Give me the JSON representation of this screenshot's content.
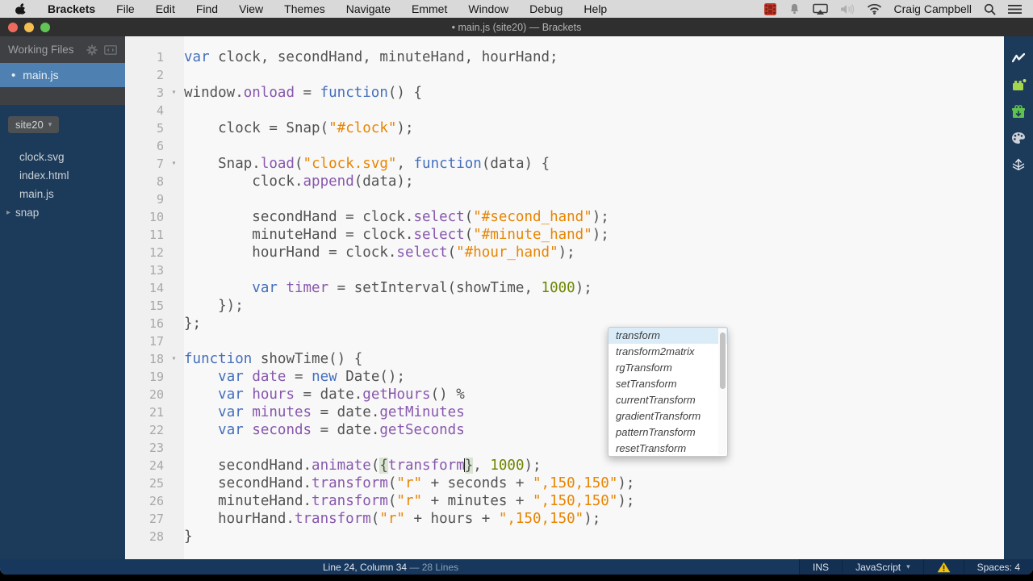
{
  "menu_bar": {
    "app_name": "Brackets",
    "items": [
      "File",
      "Edit",
      "Find",
      "View",
      "Themes",
      "Navigate",
      "Emmet",
      "Window",
      "Debug",
      "Help"
    ],
    "status_icon_names": [
      "screen-recording-icon",
      "notifications-bell-icon",
      "airplay-display-icon",
      "volume-muted-icon",
      "wifi-icon"
    ],
    "user_name": "Craig Campbell",
    "right_icon_names": [
      "spotlight-search-icon",
      "notification-center-icon"
    ]
  },
  "title_bar": {
    "title": "• main.js (site20) — Brackets"
  },
  "sidebar": {
    "working_files_label": "Working Files",
    "header_icon_names": [
      "gear-icon",
      "split-view-icon"
    ],
    "working_files": [
      {
        "name": "main.js",
        "dirty_dot": "•",
        "selected": true
      }
    ],
    "project": {
      "name": "site20",
      "caret": "▾",
      "files": [
        {
          "name": "clock.svg",
          "folder": false
        },
        {
          "name": "index.html",
          "folder": false
        },
        {
          "name": "main.js",
          "folder": false
        },
        {
          "name": "snap",
          "folder": true,
          "tri": "▸"
        }
      ]
    }
  },
  "editor": {
    "fold_glyph": "▾",
    "lines": [
      {
        "n": "1",
        "fold": false,
        "tokens": [
          [
            "var",
            "kw"
          ],
          [
            " clock, secondHand, minuteHand, hourHand;",
            "pl"
          ]
        ]
      },
      {
        "n": "2",
        "fold": false,
        "tokens": []
      },
      {
        "n": "3",
        "fold": true,
        "tokens": [
          [
            "window.",
            "pl"
          ],
          [
            "onload",
            "pu"
          ],
          [
            " = ",
            "pl"
          ],
          [
            "function",
            "kw"
          ],
          [
            "() {",
            "pl"
          ]
        ]
      },
      {
        "n": "4",
        "fold": false,
        "tokens": []
      },
      {
        "n": "5",
        "fold": false,
        "tokens": [
          [
            "    clock = Snap(",
            "pl"
          ],
          [
            "\"#clock\"",
            "st"
          ],
          [
            ");",
            "pl"
          ]
        ]
      },
      {
        "n": "6",
        "fold": false,
        "tokens": []
      },
      {
        "n": "7",
        "fold": true,
        "tokens": [
          [
            "    Snap.",
            "pl"
          ],
          [
            "load",
            "pu"
          ],
          [
            "(",
            "pl"
          ],
          [
            "\"clock.svg\"",
            "st"
          ],
          [
            ", ",
            "pl"
          ],
          [
            "function",
            "kw"
          ],
          [
            "(data) {",
            "pl"
          ]
        ]
      },
      {
        "n": "8",
        "fold": false,
        "tokens": [
          [
            "        clock.",
            "pl"
          ],
          [
            "append",
            "pu"
          ],
          [
            "(data);",
            "pl"
          ]
        ]
      },
      {
        "n": "9",
        "fold": false,
        "tokens": []
      },
      {
        "n": "10",
        "fold": false,
        "tokens": [
          [
            "        secondHand = clock.",
            "pl"
          ],
          [
            "select",
            "pu"
          ],
          [
            "(",
            "pl"
          ],
          [
            "\"#second_hand\"",
            "st"
          ],
          [
            ");",
            "pl"
          ]
        ]
      },
      {
        "n": "11",
        "fold": false,
        "tokens": [
          [
            "        minuteHand = clock.",
            "pl"
          ],
          [
            "select",
            "pu"
          ],
          [
            "(",
            "pl"
          ],
          [
            "\"#minute_hand\"",
            "st"
          ],
          [
            ");",
            "pl"
          ]
        ]
      },
      {
        "n": "12",
        "fold": false,
        "tokens": [
          [
            "        hourHand = clock.",
            "pl"
          ],
          [
            "select",
            "pu"
          ],
          [
            "(",
            "pl"
          ],
          [
            "\"#hour_hand\"",
            "st"
          ],
          [
            ");",
            "pl"
          ]
        ]
      },
      {
        "n": "13",
        "fold": false,
        "tokens": []
      },
      {
        "n": "14",
        "fold": false,
        "tokens": [
          [
            "        ",
            "pl"
          ],
          [
            "var",
            "kw"
          ],
          [
            " ",
            "pl"
          ],
          [
            "timer",
            "pu"
          ],
          [
            " = setInterval(showTime, ",
            "pl"
          ],
          [
            "1000",
            "nu"
          ],
          [
            ");",
            "pl"
          ]
        ]
      },
      {
        "n": "15",
        "fold": false,
        "tokens": [
          [
            "    });",
            "pl"
          ]
        ]
      },
      {
        "n": "16",
        "fold": false,
        "tokens": [
          [
            "};",
            "pl"
          ]
        ]
      },
      {
        "n": "17",
        "fold": false,
        "tokens": []
      },
      {
        "n": "18",
        "fold": true,
        "tokens": [
          [
            "function",
            "kw"
          ],
          [
            " showTime() {",
            "pl"
          ]
        ]
      },
      {
        "n": "19",
        "fold": false,
        "tokens": [
          [
            "    ",
            "pl"
          ],
          [
            "var",
            "kw"
          ],
          [
            " ",
            "pl"
          ],
          [
            "date",
            "pu"
          ],
          [
            " = ",
            "pl"
          ],
          [
            "new",
            "kw"
          ],
          [
            " Date();",
            "pl"
          ]
        ]
      },
      {
        "n": "20",
        "fold": false,
        "tokens": [
          [
            "    ",
            "pl"
          ],
          [
            "var",
            "kw"
          ],
          [
            " ",
            "pl"
          ],
          [
            "hours",
            "pu"
          ],
          [
            " = date.",
            "pl"
          ],
          [
            "getHours",
            "pu"
          ],
          [
            "() % ",
            "pl"
          ]
        ]
      },
      {
        "n": "21",
        "fold": false,
        "tokens": [
          [
            "    ",
            "pl"
          ],
          [
            "var",
            "kw"
          ],
          [
            " ",
            "pl"
          ],
          [
            "minutes",
            "pu"
          ],
          [
            " = date.",
            "pl"
          ],
          [
            "getMinutes",
            "pu"
          ]
        ]
      },
      {
        "n": "22",
        "fold": false,
        "tokens": [
          [
            "    ",
            "pl"
          ],
          [
            "var",
            "kw"
          ],
          [
            " ",
            "pl"
          ],
          [
            "seconds",
            "pu"
          ],
          [
            " = date.",
            "pl"
          ],
          [
            "getSeconds",
            "pu"
          ]
        ]
      },
      {
        "n": "23",
        "fold": false,
        "tokens": []
      },
      {
        "n": "24",
        "fold": false,
        "tokens": [
          [
            "    secondHand.",
            "pl"
          ],
          [
            "animate",
            "pu"
          ],
          [
            "(",
            "pl"
          ],
          [
            "{",
            "br"
          ],
          [
            "transform",
            "pu"
          ],
          [
            "",
            "cur"
          ],
          [
            "}",
            "br"
          ],
          [
            ", ",
            "pl"
          ],
          [
            "1000",
            "nu"
          ],
          [
            ");",
            "pl"
          ]
        ]
      },
      {
        "n": "25",
        "fold": false,
        "tokens": [
          [
            "    secondHand.",
            "pl"
          ],
          [
            "transform",
            "pu"
          ],
          [
            "(",
            "pl"
          ],
          [
            "\"r\"",
            "st"
          ],
          [
            " + seconds + ",
            "pl"
          ],
          [
            "\",150,150\"",
            "st"
          ],
          [
            ");",
            "pl"
          ]
        ]
      },
      {
        "n": "26",
        "fold": false,
        "tokens": [
          [
            "    minuteHand.",
            "pl"
          ],
          [
            "transform",
            "pu"
          ],
          [
            "(",
            "pl"
          ],
          [
            "\"r\"",
            "st"
          ],
          [
            " + minutes + ",
            "pl"
          ],
          [
            "\",150,150\"",
            "st"
          ],
          [
            ");",
            "pl"
          ]
        ]
      },
      {
        "n": "27",
        "fold": false,
        "tokens": [
          [
            "    hourHand.",
            "pl"
          ],
          [
            "transform",
            "pu"
          ],
          [
            "(",
            "pl"
          ],
          [
            "\"r\"",
            "st"
          ],
          [
            " + hours + ",
            "pl"
          ],
          [
            "\",150,150\"",
            "st"
          ],
          [
            ");",
            "pl"
          ]
        ]
      },
      {
        "n": "28",
        "fold": false,
        "tokens": [
          [
            "}",
            "pl"
          ]
        ]
      }
    ]
  },
  "autocomplete": {
    "items": [
      "transform",
      "transform2matrix",
      "rgTransform",
      "setTransform",
      "currentTransform",
      "gradientTransform",
      "patternTransform",
      "resetTransform"
    ],
    "selected_index": 0
  },
  "right_toolbar_icon_names": [
    "live-preview-icon",
    "extension-manager-brick-icon",
    "gift-extract-icon",
    "theme-palette-icon",
    "layers-upload-icon"
  ],
  "status_bar": {
    "cursor_info": "Line 24, Column 34",
    "separator": " — ",
    "lines_info": "28 Lines",
    "overwrite_label": "INS",
    "language_label": "JavaScript",
    "language_caret": "▾",
    "warning_icon_name": "warning-triangle-icon",
    "spaces_label": "Spaces: 4"
  },
  "colors": {
    "selection_blue": "#4e81b2",
    "sidebar_navy": "#1c3a59",
    "keyword_blue": "#446fbd",
    "property_purple": "#8757ad",
    "string_orange": "#e88501",
    "number_green": "#6d8600",
    "warning_yellow": "#f2c40d",
    "editor_bg": "#f8f8f8",
    "gutter_bg": "#f0f0f0"
  }
}
